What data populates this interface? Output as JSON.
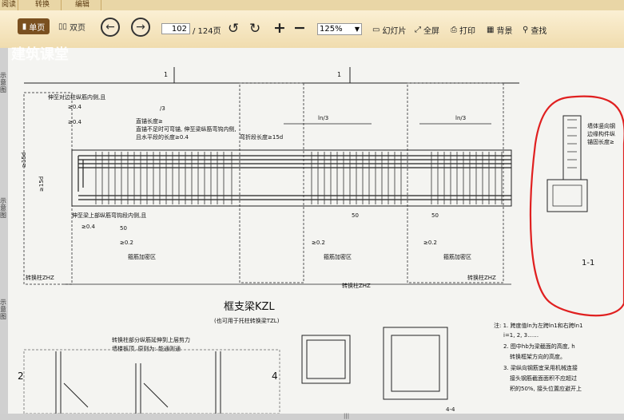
{
  "tabs": [
    "阅读",
    "转换",
    "编辑"
  ],
  "toolbar": {
    "single_page": "单页",
    "double_page": "双页",
    "page_current": "102",
    "page_total": "/ 124页",
    "zoom": "125%",
    "slideshow": "幻灯片",
    "fullscreen": "全屏",
    "print": "打印",
    "background": "背景",
    "find": "查找"
  },
  "left_strip_text": [
    "示",
    "意",
    "图",
    "示",
    "意",
    "图",
    "示",
    "意",
    "图"
  ],
  "watermark": "建筑课堂",
  "drawing": {
    "section_marks": [
      "1",
      "1"
    ],
    "title": "框支梁KZL",
    "subtitle": "(也可用于托柱转换梁TZL)",
    "callout_top": "伸至对边柱纵筋内侧,且",
    "callout_top_2": "≥0.4",
    "callout_top_3": "≥0.4",
    "frac_label": "/3",
    "notes_block": [
      "直锚长度≥",
      "直锚不足时可弯锚, 伸至梁纵筋弯钩内侧,",
      "且水平段的长度≥0.4",
      "弯折段长度≥15d"
    ],
    "ln_labels": [
      "ln/3",
      "ln/3"
    ],
    "left_labels": [
      "≥15d",
      "≥15d"
    ],
    "bottom_callout": "伸至梁上部纵筋弯钩段内侧,且",
    "bottom_callout_2": "≥0.4",
    "dim_50": "50",
    "dim_50b": "50",
    "dense_zone_1": "≥0.2",
    "dense_zone_2": "≥0.2",
    "dense_zone_3": "≥0.2",
    "dense_zone_label": "箍筋加密区",
    "dense_zone_label_2": "箍筋加密区",
    "dense_zone_label_3": "箍筋加密区",
    "transfer_col": "转换柱ZHZ",
    "transfer_col_2": "转换柱ZHZ",
    "transfer_col_3": "转换柱ZHZ",
    "section_11": "1-1",
    "section_right": "墙体竖向钢",
    "section_right_2": "边缘构件纵",
    "section_right_3": "锚固长度≥",
    "bottom_left_1": "转换柱部分纵筋延伸到上层剪力",
    "bottom_left_2": "墙楼板顶, 原则为: 能通则通",
    "section_2": "2",
    "section_4": "4",
    "section_44": "4-4",
    "note_lines": [
      "注: 1. 跨度值ln为左跨ln1和右跨ln1",
      "i=1, 2, 3……",
      "2. 图中hb为梁截面的高度, h",
      "转换框架方向的高度。",
      "3. 梁纵向钢筋宜采用机械连接",
      "接头钢筋截面面积不应超过",
      "积的50%, 接头位置应避开上"
    ]
  }
}
